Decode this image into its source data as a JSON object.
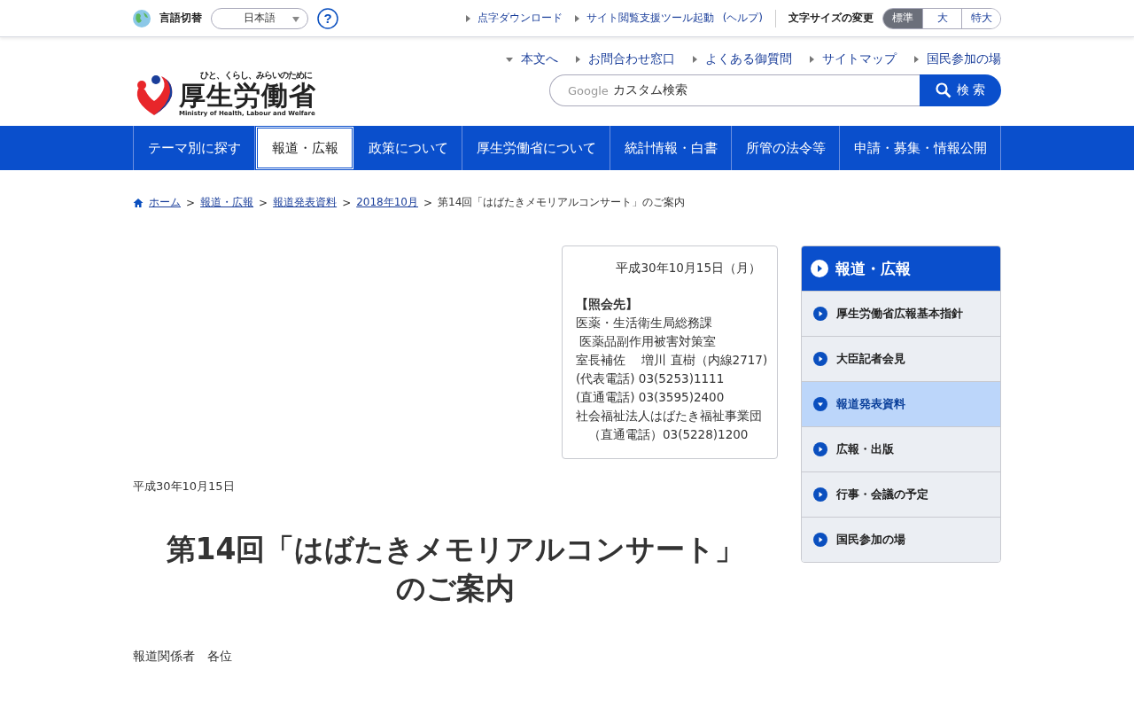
{
  "top_bar": {
    "language_label": "言語切替",
    "language": "日本語",
    "help_icon": "?",
    "links": [
      "点字ダウンロード",
      "サイト閲覧支援ツール起動"
    ],
    "help": "(ヘルプ)",
    "font_size_label": "文字サイズの変更",
    "font_sizes": [
      {
        "label": "標準",
        "selected": true
      },
      {
        "label": "大",
        "selected": false
      },
      {
        "label": "特大",
        "selected": false
      }
    ]
  },
  "header": {
    "logo": {
      "tagline": "ひと、くらし、みらいのために",
      "name": "厚生労働省",
      "english": "Ministry of Health, Labour and Welfare"
    },
    "links": [
      {
        "label": "本文へ",
        "kind": "down"
      },
      {
        "label": "お問合わせ窓口",
        "kind": "right"
      },
      {
        "label": "よくある御質問",
        "kind": "right"
      },
      {
        "label": "サイトマップ",
        "kind": "right"
      },
      {
        "label": "国民参加の場",
        "kind": "right"
      }
    ],
    "search": {
      "brand": "Google",
      "placeholder": "カスタム検索",
      "button": "検 索"
    }
  },
  "nav": [
    {
      "label": "テーマ別に探す",
      "selected": false
    },
    {
      "label": "報道・広報",
      "selected": true
    },
    {
      "label": "政策について",
      "selected": false
    },
    {
      "label": "厚生労働省について",
      "selected": false
    },
    {
      "label": "統計情報・白書",
      "selected": false
    },
    {
      "label": "所管の法令等",
      "selected": false
    },
    {
      "label": "申請・募集・情報公開",
      "selected": false
    }
  ],
  "breadcrumb": {
    "separator": ">",
    "links": [
      "ホーム",
      "報道・広報",
      "報道発表資料",
      "2018年10月"
    ],
    "current": "第14回「はばたきメモリアルコンサート」のご案内"
  },
  "contact": {
    "date": "平成30年10月15日（月）",
    "heading": "【照会先】",
    "lines": [
      "医薬・生活衛生局総務課",
      " 医薬品副作用被害対策室",
      "室長補佐　 増川 直樹（内線2717)",
      "(代表電話) 03(5253)1111",
      "(直通電話) 03(3595)2400",
      "社会福祉法人はばたき福祉事業団",
      "　（直通電話）03(5228)1200"
    ]
  },
  "article": {
    "date": "平成30年10月15日",
    "title": "第14回「はばたきメモリアルコンサート」のご案内",
    "addressee": "報道関係者　各位"
  },
  "sidebar": {
    "title": "報道・広報",
    "items": [
      {
        "label": "厚生労働省広報基本指針",
        "selected": false
      },
      {
        "label": "大臣記者会見",
        "selected": false
      },
      {
        "label": "報道発表資料",
        "selected": true
      },
      {
        "label": "広報・出版",
        "selected": false
      },
      {
        "label": "行事・会議の予定",
        "selected": false
      },
      {
        "label": "国民参加の場",
        "selected": false
      }
    ]
  }
}
